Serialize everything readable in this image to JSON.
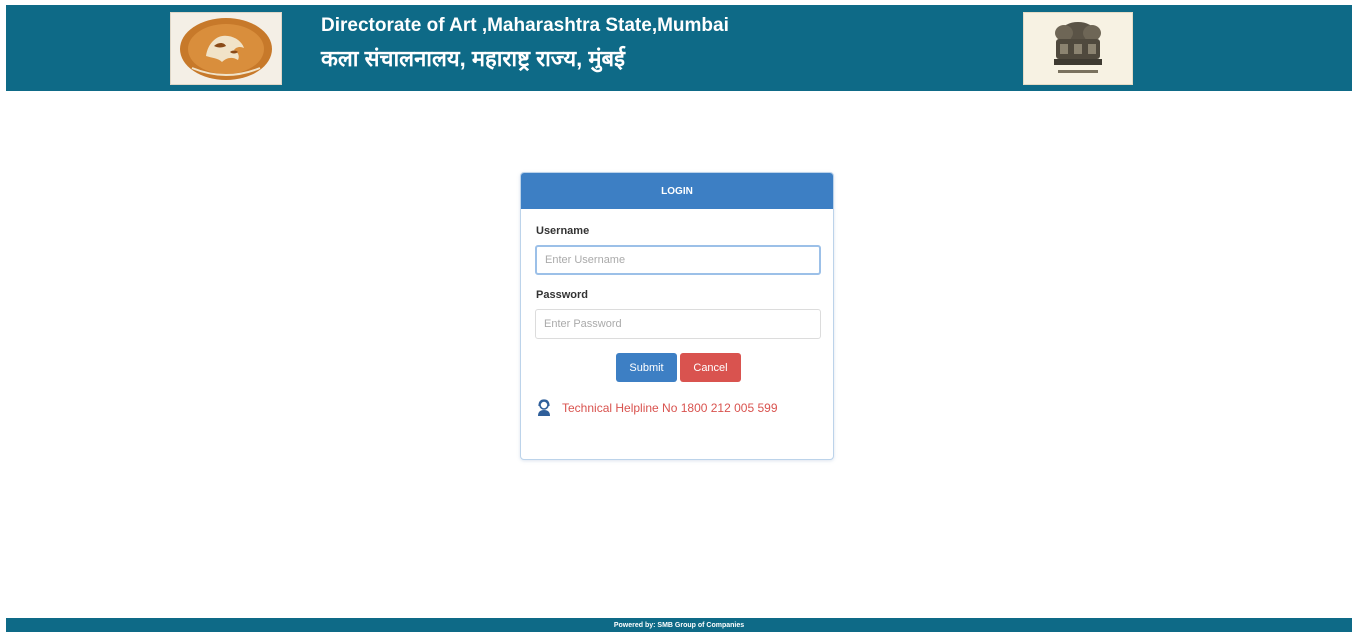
{
  "header": {
    "title_en": "Directorate of Art ,Maharashtra State,Mumbai",
    "title_mr": "कला संचालनालय, महाराष्ट्र राज्य, मुंबई",
    "background_color": "#0e6a87",
    "logo_left_icon": "directorate-of-art-emblem",
    "logo_right_icon": "national-emblem"
  },
  "login": {
    "heading": "LOGIN",
    "username_label": "Username",
    "username_placeholder": "Enter Username",
    "username_value": "",
    "password_label": "Password",
    "password_placeholder": "Enter Password",
    "password_value": "",
    "submit_label": "Submit",
    "cancel_label": "Cancel",
    "helpline_icon": "support-agent-icon",
    "helpline_text": "Technical Helpline No 1800 212 005 599",
    "accent_color": "#3d7fc4",
    "danger_color": "#d9534f"
  },
  "footer": {
    "text": "Powered by: SMB Group of Companies"
  }
}
